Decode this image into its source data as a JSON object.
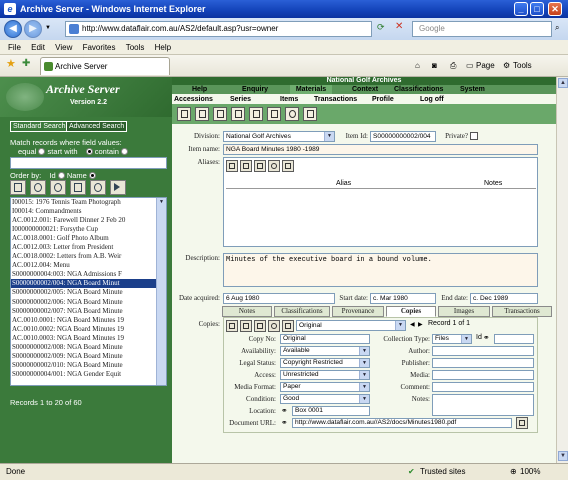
{
  "browser": {
    "title": "Archive Server - Windows Internet Explorer",
    "url": "http://www.dataflair.com.au/AS2/default.asp?usr=owner",
    "search_placeholder": "Google",
    "menu": [
      "File",
      "Edit",
      "View",
      "Favorites",
      "Tools",
      "Help"
    ],
    "tab_title": "Archive Server",
    "toolbar": {
      "page": "Page",
      "tools": "Tools"
    },
    "status": {
      "left": "Done",
      "zone": "Trusted sites",
      "zoom": "100%"
    }
  },
  "left": {
    "app_name": "Archive Server",
    "version": "Version 2.2",
    "tabs": [
      "Standard Search",
      "Advanced Search"
    ],
    "match_label": "Match records where field values:",
    "match_options": [
      "equal",
      "start with",
      "contain"
    ],
    "match_selected": "start with",
    "order_label": "Order by:",
    "order_options": [
      "Id",
      "Name"
    ],
    "order_selected": "Name",
    "records": [
      "I00015:  1976 Tennis Team Photograph",
      "I00014:  Commandments",
      "AC.0012.001:  Farewell Dinner 2 Feb 20",
      "I000000000021:  Forsythe Cup",
      "AC.0018.0001:  Golf Photo Album",
      "AC.0012.003:  Letter from President",
      "AC.0018.0002:  Letters from A.B. Weir",
      "AC.0012.004:  Menu",
      "S0000000004:003:  NGA Admissions F",
      "S0000000002/004:  NGA Board Minut",
      "S0000000002/005:  NGA Board Minute",
      "S0000000002/006:  NGA Board Minute",
      "S0000000002/007:  NGA Board Minute",
      "AC.0010.0001:  NGA Board Minutes 19",
      "AC.0010.0002:  NGA Board Minutes 19",
      "AC.0010.0003:  NGA Board Minutes 19",
      "S0000000002/008:  NGA Board Minute",
      "S0000000002/009:  NGA Board Minute",
      "S0000000002/010:  NGA Board Minute",
      "S0000000004/001:  NGA Gender Equit"
    ],
    "selected_index": 9,
    "records_count": "Records 1 to 20 of 60"
  },
  "right": {
    "header": "National Golf Archives",
    "menu_row1": [
      "Help",
      "Enquiry",
      "Materials",
      "Context",
      "Classifications",
      "System"
    ],
    "menu_row2": [
      "Accessions",
      "Series",
      "Items",
      "Transactions",
      "Profile",
      "Log off"
    ],
    "division_label": "Division:",
    "division_value": "National Golf Archives",
    "item_id_label": "Item Id:",
    "item_id_value": "S00000000002/004",
    "private_label": "Private?",
    "item_name_label": "Item name:",
    "item_name_value": "NGA Board Minutes 1980 -1989",
    "aliases_label": "Aliases:",
    "alias_col": "Alias",
    "notes_col": "Notes",
    "description_label": "Description:",
    "description_value": "Minutes of the executive board in a bound volume.",
    "date_acquired_label": "Date acquired:",
    "date_acquired_value": "6 Aug 1980",
    "start_date_label": "Start date:",
    "start_date_value": "c. Mar 1980",
    "end_date_label": "End date:",
    "end_date_value": "c. Dec 1989",
    "tabs": [
      "Notes",
      "Classifications",
      "Provenance",
      "Copies",
      "Images",
      "Transactions"
    ],
    "active_tab": "Copies",
    "copies": {
      "label": "Copies:",
      "copy_select": "Original",
      "record_counter": "Record 1 of 1",
      "copy_no_label": "Copy No:",
      "copy_no_value": "Original",
      "collection_type_label": "Collection Type:",
      "collection_type_value": "Files",
      "id_label": "Id",
      "availability_label": "Availability:",
      "availability_value": "Available",
      "author_label": "Author:",
      "legal_status_label": "Legal Status:",
      "legal_status_value": "Copyright Restricted",
      "publisher_label": "Publisher:",
      "access_label": "Access:",
      "access_value": "Unrestricted",
      "media_label": "Media:",
      "media_format_label": "Media Format:",
      "media_format_value": "Paper",
      "comment_label": "Comment:",
      "condition_label": "Condition:",
      "condition_value": "Good",
      "notes_label": "Notes:",
      "location_label": "Location:",
      "location_value": "Box 0001",
      "document_url_label": "Document URL:",
      "document_url_value": "http://www.dataflair.com.au//AS2/docs/Minutes1980.pdf"
    }
  }
}
